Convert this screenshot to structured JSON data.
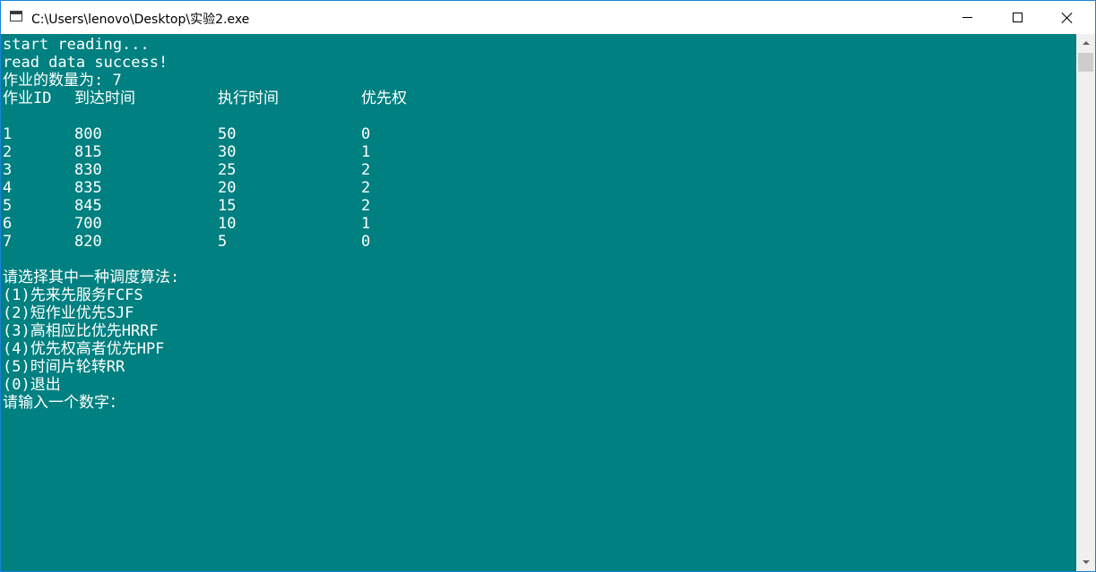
{
  "window": {
    "title": "C:\\Users\\lenovo\\Desktop\\实验2.exe"
  },
  "console": {
    "background": "#008080",
    "foreground": "#ffffff",
    "lines_top": [
      "start reading...",
      "read data success!",
      "作业的数量为: 7"
    ],
    "table": {
      "headers": [
        "作业ID",
        "到达时间",
        "执行时间",
        "优先权"
      ],
      "rows": [
        [
          "1",
          "800",
          "50",
          "0"
        ],
        [
          "2",
          "815",
          "30",
          "1"
        ],
        [
          "3",
          "830",
          "25",
          "2"
        ],
        [
          "4",
          "835",
          "20",
          "2"
        ],
        [
          "5",
          "845",
          "15",
          "2"
        ],
        [
          "6",
          "700",
          "10",
          "1"
        ],
        [
          "7",
          "820",
          "5",
          "0"
        ]
      ]
    },
    "menu": {
      "prompt_title": "请选择其中一种调度算法:",
      "options": [
        "(1)先来先服务FCFS",
        "(2)短作业优先SJF",
        "(3)高相应比优先HRRF",
        "(4)优先权高者优先HPF",
        "(5)时间片轮转RR",
        "(0)退出"
      ],
      "input_prompt": "请输入一个数字："
    }
  },
  "icons": {
    "app": "console-app-icon",
    "minimize": "minimize-icon",
    "maximize": "maximize-icon",
    "close": "close-icon"
  }
}
